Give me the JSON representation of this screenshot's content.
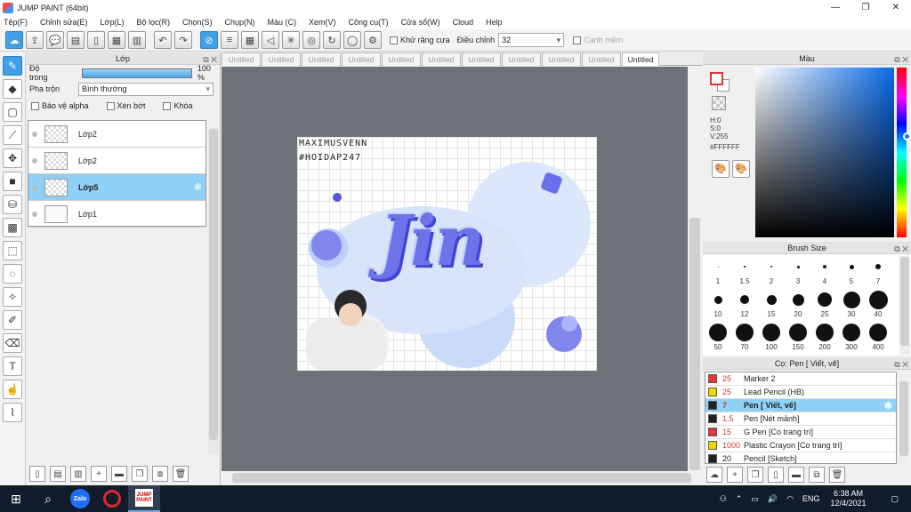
{
  "window": {
    "title": "JUMP PAINT (64bit)",
    "minimize": "—",
    "maximize": "❐",
    "close": "✕"
  },
  "menu": [
    "Tệp(F)",
    "Chỉnh sửa(E)",
    "Lớp(L)",
    "Bộ lọc(R)",
    "Chọn(S)",
    "Chụp(N)",
    "Màu (C)",
    "Xem(V)",
    "Công cụ(T)",
    "Cửa sổ(W)",
    "Cloud",
    "Help"
  ],
  "toolbar": {
    "antialias_label": "Khử răng cưa",
    "adjust_label": "Điều chỉnh",
    "adjust_value": "32",
    "smooth_label": "Cạnh mềm"
  },
  "layer_panel": {
    "title": "Lớp",
    "opacity_label": "Độ trong",
    "opacity_value": "100 %",
    "opacity_fraction": 1.0,
    "blend_label": "Pha trộn",
    "blend_value": "Bình thường",
    "protect_alpha": "Bảo vệ alpha",
    "clipping": "Xén bớt",
    "lock": "Khóa",
    "layers": [
      {
        "name": "Lớp2",
        "selected": false
      },
      {
        "name": "Lớp2",
        "selected": false
      },
      {
        "name": "Lớp5",
        "selected": true
      },
      {
        "name": "Lớp1",
        "selected": false
      }
    ]
  },
  "tabs": [
    "Untitled",
    "Untitled",
    "Untitled",
    "Untitled",
    "Untitled",
    "Untitled",
    "Untitled",
    "Untitled",
    "Untitled",
    "Untitled",
    "Untitled"
  ],
  "active_tab": 10,
  "artwork": {
    "watermark_line1": "MAXIMUSVENN",
    "watermark_line2": "#HOIDAP247",
    "word": "Jin"
  },
  "color_panel": {
    "title": "Màu",
    "h": "H:0",
    "s": "S:0",
    "v": "V:255",
    "hex": "#FFFFFF",
    "foreground": "#FFFFFF",
    "accent": "#e33333"
  },
  "brush_panel": {
    "title": "Brush Size",
    "sizes": [
      "1",
      "1.5",
      "2",
      "3",
      "4",
      "5",
      "7",
      "10",
      "12",
      "15",
      "20",
      "25",
      "30",
      "40",
      "50",
      "70",
      "100",
      "150",
      "200",
      "300",
      "400"
    ]
  },
  "tool_panel": {
    "title": "Cọ: Pen [ Viết, vẽ]",
    "items": [
      {
        "size": "25",
        "name": "Marker 2",
        "color": "#e53935",
        "selected": false
      },
      {
        "size": "25",
        "name": "Lead Pencil (HB)",
        "color": "#f2d600",
        "selected": false
      },
      {
        "size": "7",
        "name": "Pen [ Viết, vẽ]",
        "color": "#222222",
        "selected": true
      },
      {
        "size": "1.5",
        "name": "Pen [Nét mảnh]",
        "color": "#222222",
        "selected": false
      },
      {
        "size": "15",
        "name": "G Pen [Co trang trí]",
        "color": "#e53935",
        "selected": false
      },
      {
        "size": "1000",
        "name": "Plastic Crayon [Co trang trí]",
        "color": "#f2d600",
        "selected": false
      },
      {
        "size": "20",
        "name": "Pencil [Sketch]",
        "color": "#222222",
        "selected": false
      }
    ]
  },
  "taskbar": {
    "zalo": "Zalo",
    "jp": "JUMP PAINT",
    "lang": "ENG",
    "time": "6:38 AM",
    "date": "12/4/2021"
  }
}
